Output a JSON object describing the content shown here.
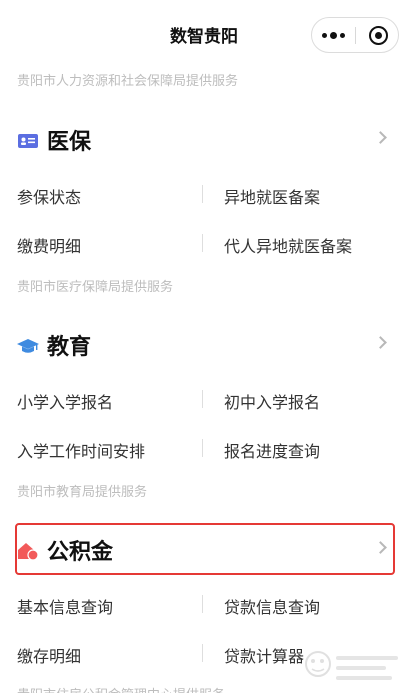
{
  "app": {
    "title": "数智贵阳"
  },
  "sections": [
    {
      "provider_top": "贵阳市人力资源和社会保障局提供服务",
      "title": "医保",
      "icon": "id-card-icon",
      "icon_color": "#5b6ee1",
      "services": [
        "参保状态",
        "异地就医备案",
        "缴费明细",
        "代人异地就医备案"
      ],
      "provider": "贵阳市医疗保障局提供服务"
    },
    {
      "title": "教育",
      "icon": "graduation-cap-icon",
      "icon_color": "#3f8be0",
      "services": [
        "小学入学报名",
        "初中入学报名",
        "入学工作时间安排",
        "报名进度查询"
      ],
      "provider": "贵阳市教育局提供服务"
    },
    {
      "title": "公积金",
      "icon": "house-icon",
      "icon_color": "#f25a5a",
      "services": [
        "基本信息查询",
        "贷款信息查询",
        "缴存明细",
        "贷款计算器"
      ],
      "provider": "贵阳市住房公积金管理中心提供服务"
    }
  ],
  "colors": {
    "highlight": "#e53935",
    "muted_text": "#bdbdbd"
  }
}
